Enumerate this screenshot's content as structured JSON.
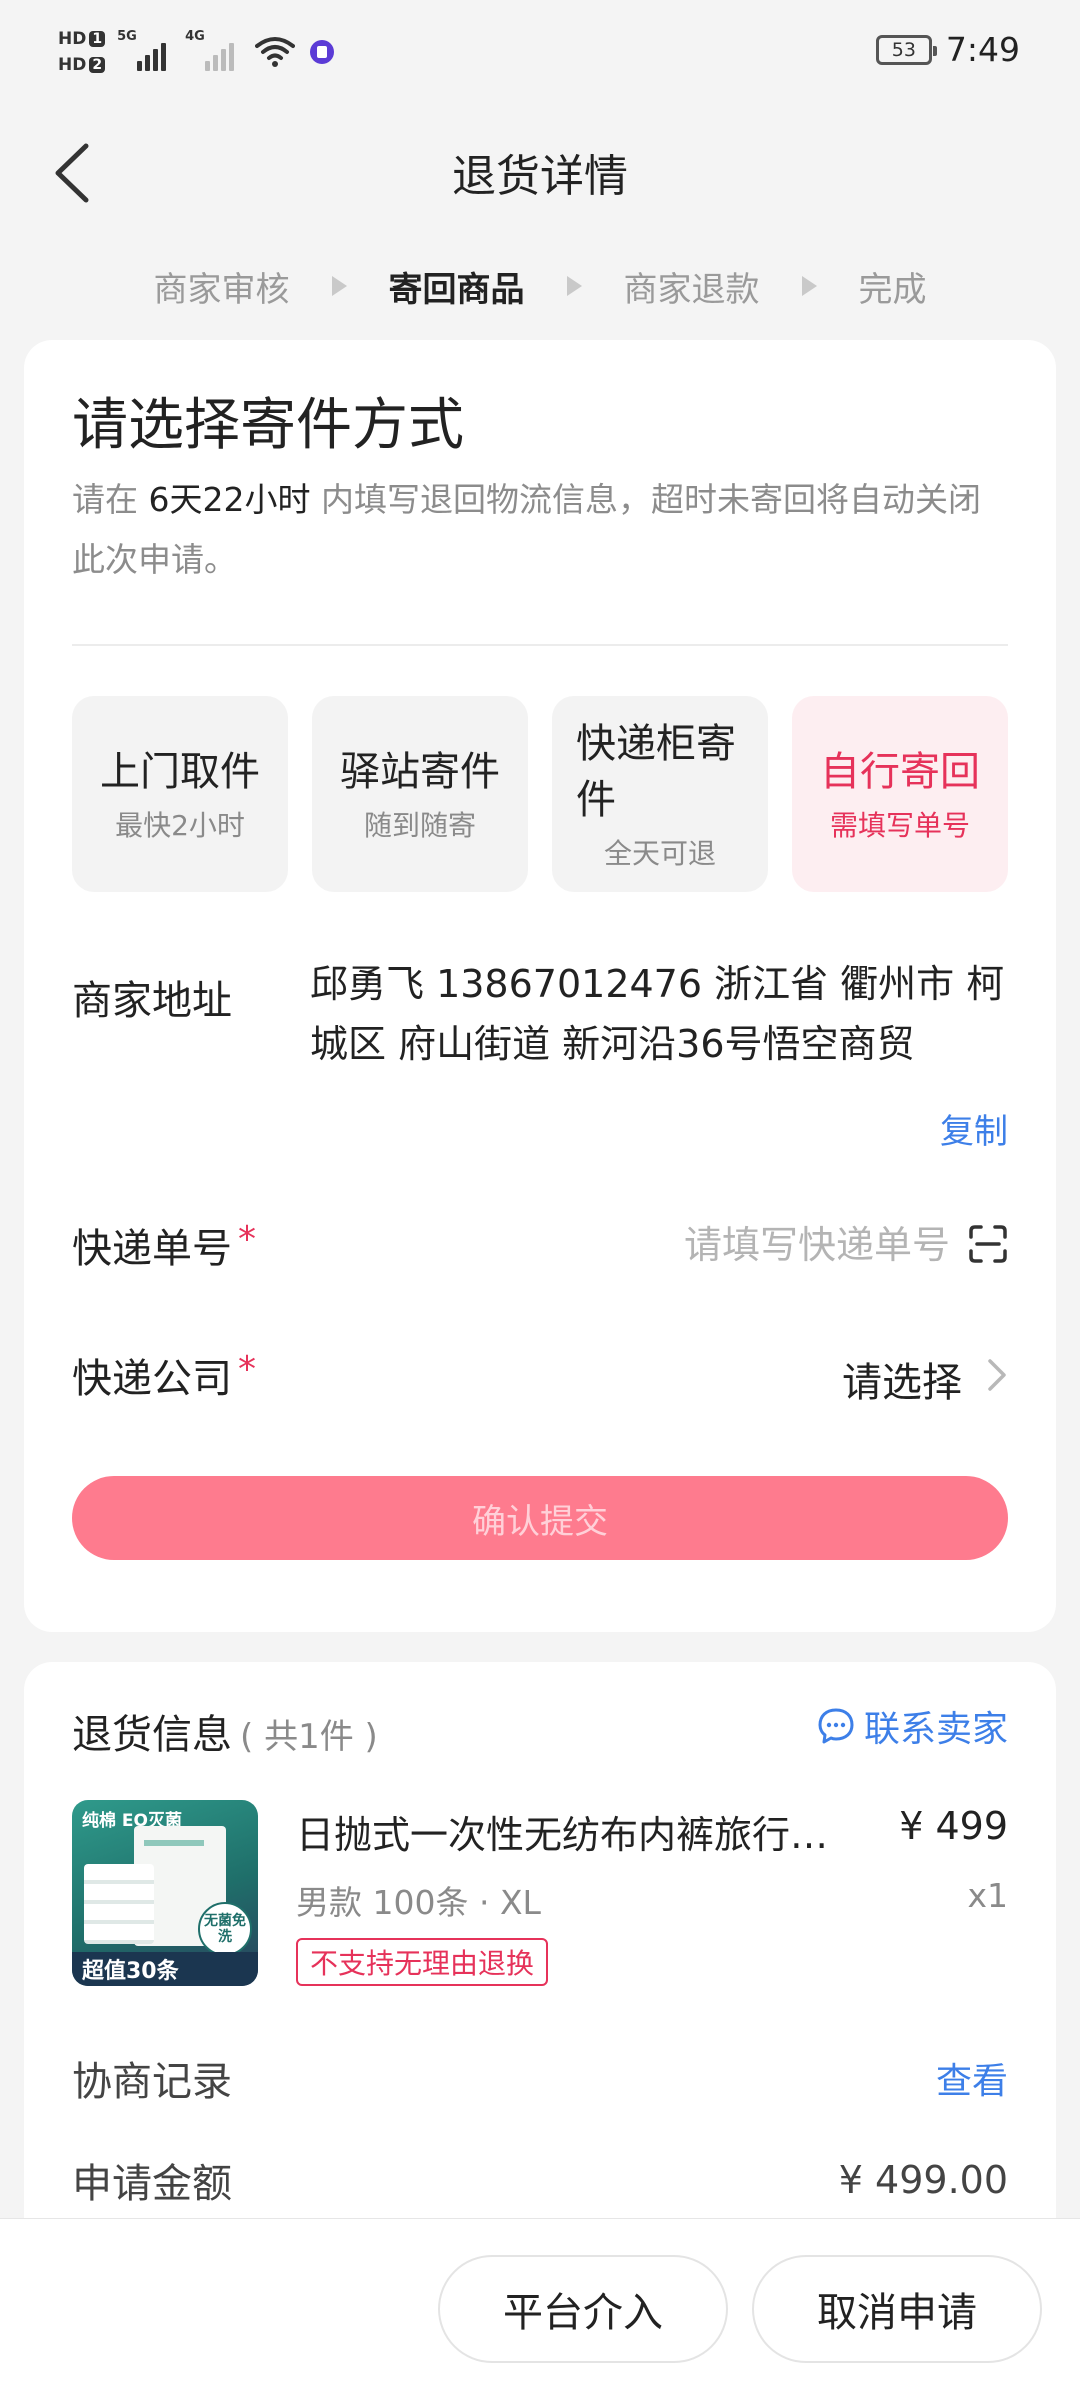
{
  "status_bar": {
    "hd1": "HD",
    "hd1_num": "1",
    "hd2": "HD",
    "hd2_num": "2",
    "net1": "5G",
    "net2": "4G",
    "battery": "53",
    "time": "7:49",
    "icons": [
      "signal-icon",
      "wifi-icon",
      "app-badge-icon",
      "battery-icon"
    ]
  },
  "header": {
    "title": "退货详情",
    "back_icon": "chevron-left-icon"
  },
  "steps": [
    {
      "label": "商家审核",
      "active": false
    },
    {
      "label": "寄回商品",
      "active": true
    },
    {
      "label": "商家退款",
      "active": false
    },
    {
      "label": "完成",
      "active": false
    }
  ],
  "shipping": {
    "title": "请选择寄件方式",
    "note_prefix": "请在 ",
    "note_highlight": "6天22小时",
    "note_suffix": " 内填写退回物流信息，超时未寄回将自动关闭此次申请。",
    "methods": [
      {
        "label": "上门取件",
        "sub": "最快2小时",
        "selected": false
      },
      {
        "label": "驿站寄件",
        "sub": "随到随寄",
        "selected": false
      },
      {
        "label": "快递柜寄件",
        "sub": "全天可退",
        "selected": false
      },
      {
        "label": "自行寄回",
        "sub": "需填写单号",
        "selected": true
      }
    ],
    "address_label": "商家地址",
    "address_text": "邱勇飞 13867012476 浙江省 衢州市 柯城区 府山街道 新河沿36号悟空商贸",
    "copy_label": "复制",
    "tracking_label": "快递单号",
    "tracking_placeholder": "请填写快递单号",
    "tracking_value": "",
    "company_label": "快递公司",
    "company_value": "请选择",
    "required_mark": "*",
    "submit_label": "确认提交"
  },
  "return_info": {
    "title": "退货信息",
    "count": "( 共1件 )",
    "contact_label": "联系卖家",
    "product": {
      "name": "日抛式一次性无纺布内裤旅行…",
      "price": "¥ 499",
      "spec": "男款 100条 · XL",
      "qty": "x1",
      "tag": "不支持无理由退换",
      "img_top": "纯棉 EO灭菌",
      "img_badge": "无菌免洗",
      "img_bottom": "超值30条"
    },
    "negotiation_label": "协商记录",
    "negotiation_link": "查看",
    "amount_label": "申请金额",
    "amount_value": "¥ 499.00"
  },
  "bottom_bar": {
    "intervene_label": "平台介入",
    "cancel_label": "取消申请"
  },
  "colors": {
    "accent": "#e6325a",
    "submit_bg": "#fe7b8e",
    "link": "#3d7fe8",
    "page_bg": "#f4f4f4"
  }
}
